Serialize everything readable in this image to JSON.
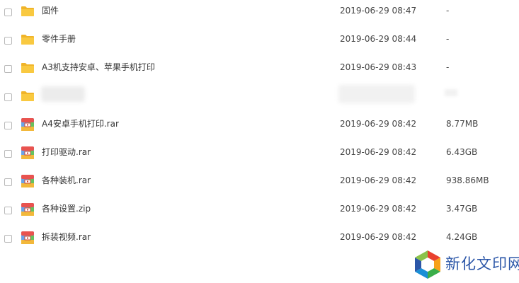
{
  "files": [
    {
      "name": "固件",
      "date": "2019-06-29 08:47",
      "size": "-",
      "icon": "folder-icon",
      "blurred": false
    },
    {
      "name": "零件手册",
      "date": "2019-06-29 08:44",
      "size": "-",
      "icon": "folder-icon",
      "blurred": false
    },
    {
      "name": "A3机支持安卓、苹果手机打印",
      "date": "2019-06-29 08:43",
      "size": "-",
      "icon": "folder-icon",
      "blurred": false
    },
    {
      "name": "",
      "date": "",
      "size": "",
      "icon": "folder-icon",
      "blurred": true
    },
    {
      "name": "A4安卓手机打印.rar",
      "date": "2019-06-29 08:42",
      "size": "8.77MB",
      "icon": "archive-icon",
      "blurred": false
    },
    {
      "name": "打印驱动.rar",
      "date": "2019-06-29 08:42",
      "size": "6.43GB",
      "icon": "archive-icon",
      "blurred": false
    },
    {
      "name": "各种装机.rar",
      "date": "2019-06-29 08:42",
      "size": "938.86MB",
      "icon": "archive-icon",
      "blurred": false
    },
    {
      "name": "各种设置.zip",
      "date": "2019-06-29 08:42",
      "size": "3.47GB",
      "icon": "archive-icon",
      "blurred": false
    },
    {
      "name": "拆装视频.rar",
      "date": "2019-06-29 08:42",
      "size": "4.24GB",
      "icon": "archive-icon",
      "blurred": false
    }
  ],
  "watermark": {
    "text": "新化文印网",
    "icon": "logo-icon"
  },
  "colors": {
    "folder": "#f9c940",
    "folder_tab": "#f0b429",
    "archive_top": "#e9534f",
    "archive_left": "#6aa4e8",
    "archive_right": "#66c25f",
    "archive_bottom": "#f2b83b",
    "watermark_text": "#2b56a8"
  }
}
